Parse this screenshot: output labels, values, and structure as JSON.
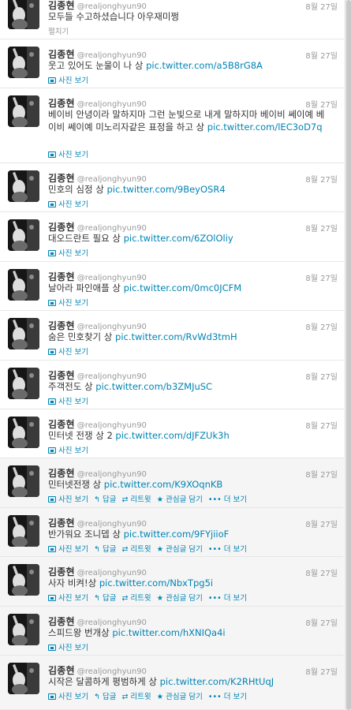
{
  "user": {
    "name": "김종현",
    "handle": "@realjonghyun90"
  },
  "labels": {
    "expand": "펼치기",
    "view_photo": "사진 보기",
    "reply": "답글",
    "retweet": "리트윗",
    "favorite": "관심글 담기",
    "more": "더 보기"
  },
  "tweets": [
    {
      "date": "8월 27일",
      "text": "모두들 수고하셨습니다 아우재미쩡",
      "link": "",
      "action_type": "expand"
    },
    {
      "date": "8월 27일",
      "text": "웃고 있어도 눈물이 나 상 ",
      "link": "pic.twitter.com/a5B8rG8A",
      "action_type": "photo"
    },
    {
      "date": "8월 27일",
      "text": "베이비 안녕이라 말하지마 그런 눈빛으로 내게 말하지마 베이비 쎄이예 베이비 쎄이예 미노리자같은 표정을 하고 상 ",
      "link": "pic.twitter.com/lEC3oD7q",
      "action_type": "photo"
    },
    {
      "date": "8월 27일",
      "text": "민호의 심정 상 ",
      "link": "pic.twitter.com/9BeyOSR4",
      "action_type": "photo"
    },
    {
      "date": "8월 27일",
      "text": "대오드란트 필요 상 ",
      "link": "pic.twitter.com/6ZOlOliy",
      "action_type": "photo"
    },
    {
      "date": "8월 27일",
      "text": "날아라 파인애플 상 ",
      "link": "pic.twitter.com/0mc0JCFM",
      "action_type": "photo"
    },
    {
      "date": "8월 27일",
      "text": "숨은 민호찾기 상 ",
      "link": "pic.twitter.com/RvWd3tmH",
      "action_type": "photo"
    },
    {
      "date": "8월 27일",
      "text": "주객전도 상 ",
      "link": "pic.twitter.com/b3ZMJuSC",
      "action_type": "photo"
    },
    {
      "date": "8월 27일",
      "text": "민터넷 전쟁 상 2 ",
      "link": "pic.twitter.com/dJFZUk3h",
      "action_type": "photo"
    },
    {
      "date": "8월 27일",
      "text": "민터넷전쟁 상 ",
      "link": "pic.twitter.com/K9XOqnKB",
      "action_type": "full"
    },
    {
      "date": "8월 27일",
      "text": "반가워요 조니뎁 상 ",
      "link": "pic.twitter.com/9FYjiioF",
      "action_type": "full"
    },
    {
      "date": "8월 27일",
      "text": "사자 비켜!상 ",
      "link": "pic.twitter.com/NbxTpg5i",
      "action_type": "full"
    },
    {
      "date": "8월 27일",
      "text": "스피드왕 번개상 ",
      "link": "pic.twitter.com/hXNIQa4i",
      "action_type": "photo"
    },
    {
      "date": "8월 27일",
      "text": "시작은 달콤하게 평범하게 상 ",
      "link": "pic.twitter.com/K2RHtUqJ",
      "action_type": "full"
    }
  ]
}
